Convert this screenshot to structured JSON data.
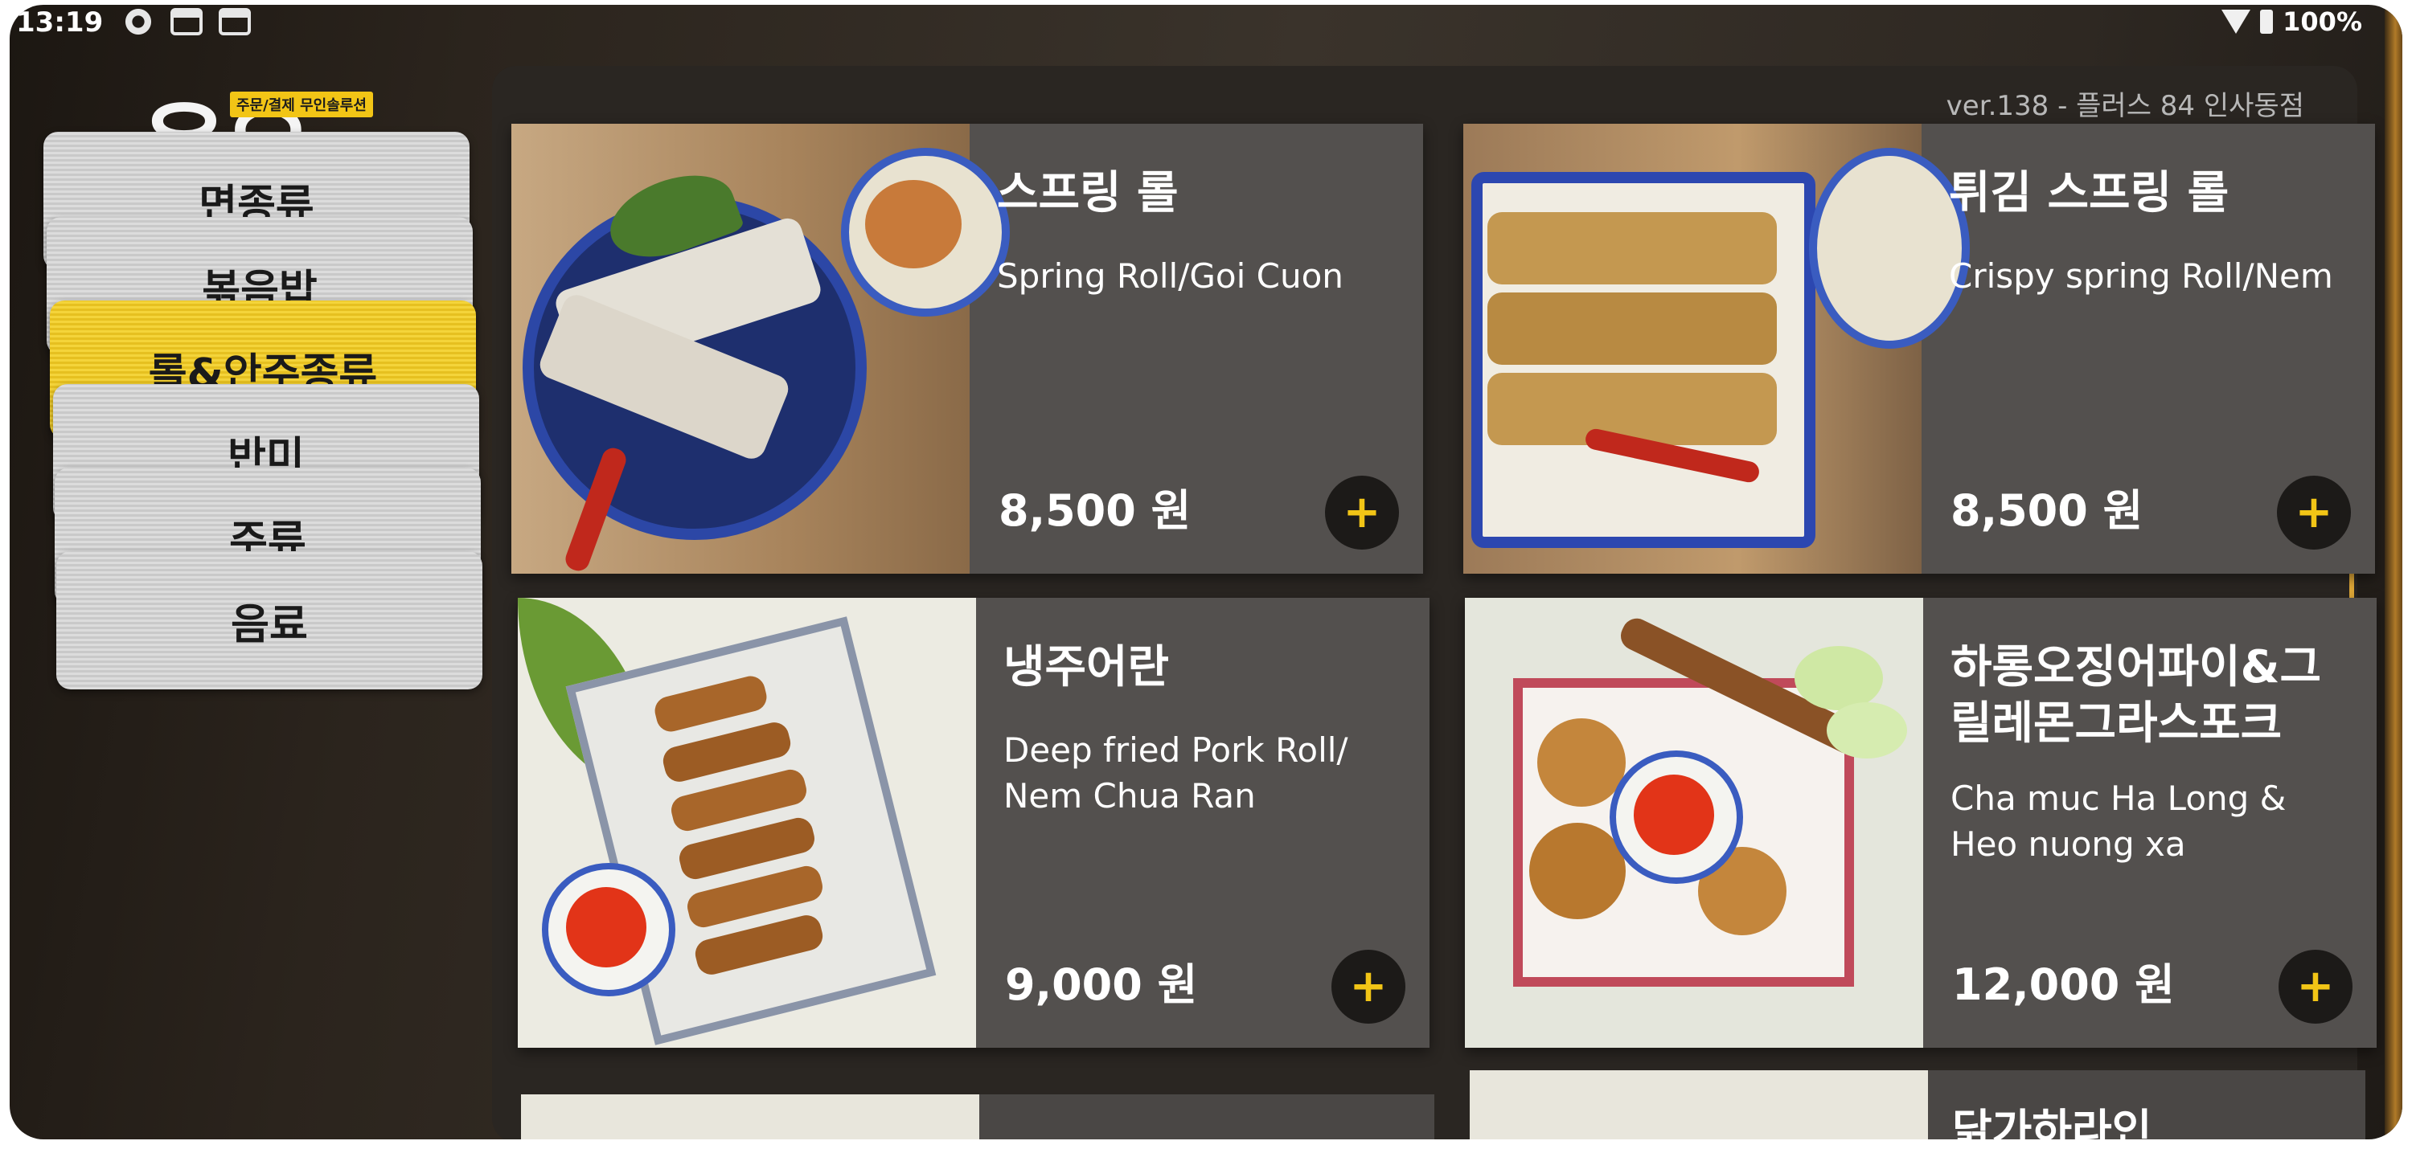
{
  "status_bar": {
    "time": "13:19",
    "battery": "100%"
  },
  "logo": {
    "mark": "온오더",
    "tagline": "주문/결제 무인솔루션"
  },
  "sidebar": {
    "items": [
      {
        "label": "면종류"
      },
      {
        "label": "볶음밥"
      },
      {
        "label": "롤&안주종류",
        "active": true
      },
      {
        "label": "반미"
      },
      {
        "label": "주류"
      },
      {
        "label": "음료"
      }
    ]
  },
  "header": {
    "version": "ver.138 - 플러스 84 인사동점"
  },
  "menu": {
    "items": [
      {
        "name_ko": "스프링 롤",
        "name_en": "Spring Roll/Goi Cuon",
        "price": "8,500 원",
        "add_label": "+"
      },
      {
        "name_ko": "튀김 스프링 롤",
        "name_en": "Crispy spring Roll/Nem",
        "price": "8,500 원",
        "add_label": "+"
      },
      {
        "name_ko": "냉주어란",
        "name_en": "Deep fried Pork Roll/ Nem Chua Ran",
        "price": "9,000 원",
        "add_label": "+"
      },
      {
        "name_ko": "하롱오징어파이&그릴레몬그라스포크",
        "name_en": "Cha muc Ha Long & Heo nuong xa",
        "price": "12,000 원",
        "add_label": "+"
      }
    ],
    "partial_next_label": "닭가하라인"
  },
  "colors": {
    "accent": "#f2c516",
    "panel": "#2a2622",
    "card": "#53504e"
  },
  "icons": {
    "settings": "gear-icon",
    "wifi": "wifi-icon",
    "battery": "battery-icon",
    "add": "plus-icon"
  }
}
